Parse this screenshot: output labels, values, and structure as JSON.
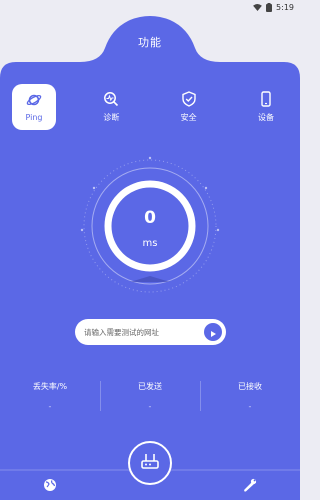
{
  "status_bar": {
    "time": "5:19"
  },
  "header": {
    "title": "功能"
  },
  "tabs": [
    {
      "label": "Ping",
      "icon": "planet-icon",
      "active": true
    },
    {
      "label": "诊断",
      "icon": "diagnose-icon",
      "active": false
    },
    {
      "label": "安全",
      "icon": "shield-icon",
      "active": false
    },
    {
      "label": "设备",
      "icon": "phone-icon",
      "active": false
    }
  ],
  "gauge": {
    "value": "0",
    "unit": "ms"
  },
  "url_input": {
    "placeholder": "请输入需要测试的网址",
    "value": ""
  },
  "stats": [
    {
      "label": "丢失率/%",
      "value": "-"
    },
    {
      "label": "已发送",
      "value": "-"
    },
    {
      "label": "已接收",
      "value": "-"
    }
  ],
  "bottom_nav": [
    {
      "icon": "globe-icon"
    },
    {
      "icon": "router-icon"
    },
    {
      "icon": "wrench-icon"
    }
  ],
  "colors": {
    "primary": "#5b68e6",
    "background": "#ececf3",
    "white": "#ffffff"
  }
}
